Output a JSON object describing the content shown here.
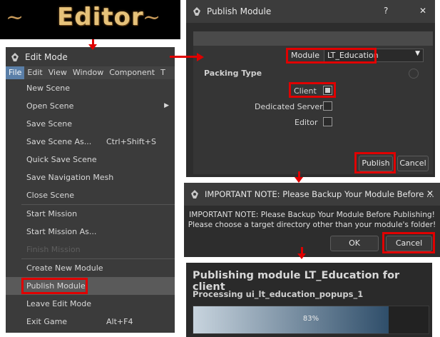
{
  "banner": {
    "title": "Editor"
  },
  "edit_window": {
    "title": "Edit Mode",
    "menubar": [
      "File",
      "Edit",
      "View",
      "Window",
      "Component",
      "T"
    ],
    "menu_items": [
      {
        "label": "New Scene",
        "shortcut": ""
      },
      {
        "label": "Open Scene",
        "shortcut": "",
        "submenu": true
      },
      {
        "label": "Save Scene",
        "shortcut": ""
      },
      {
        "label": "Save Scene As...",
        "shortcut": "Ctrl+Shift+S"
      },
      {
        "label": "Quick Save Scene",
        "shortcut": ""
      },
      {
        "label": "Save Navigation Mesh",
        "shortcut": ""
      },
      {
        "label": "Close Scene",
        "shortcut": ""
      },
      {
        "label": "Start Mission",
        "shortcut": ""
      },
      {
        "label": "Start Mission As...",
        "shortcut": ""
      },
      {
        "label": "Finish Mission",
        "shortcut": "",
        "disabled": true
      },
      {
        "label": "Create New Module",
        "shortcut": ""
      },
      {
        "label": "Publish Module",
        "shortcut": "",
        "highlighted": true
      },
      {
        "label": "Leave Edit Mode",
        "shortcut": ""
      },
      {
        "label": "Exit Game",
        "shortcut": "Alt+F4"
      }
    ]
  },
  "publish_dialog": {
    "title": "Publish Module",
    "help": "?",
    "close": "✕",
    "module_label": "Module",
    "module_value": "LT_Education",
    "packing_type_label": "Packing Type",
    "options": [
      {
        "label": "Client",
        "checked": true
      },
      {
        "label": "Dedicated Server",
        "checked": false
      },
      {
        "label": "Editor",
        "checked": false
      }
    ],
    "publish_button": "Publish",
    "cancel_button": "Cancel"
  },
  "backup_dialog": {
    "title": "IMPORTANT NOTE: Please Backup Your Module Before ...",
    "close": "✕",
    "message_line1": "IMPORTANT NOTE: Please Backup Your Module Before Publishing!",
    "message_line2": "Please choose a target directory other than your module's folder!",
    "ok_button": "OK",
    "cancel_button": "Cancel"
  },
  "progress_dialog": {
    "title": "Publishing module LT_Education for client",
    "status": "Processing ui_lt_education_popups_1",
    "progress": 0.83,
    "progress_label": "83%"
  },
  "colors": {
    "highlight_red": "#e00000",
    "menu_selected": "#5a7fa8",
    "progress_fill": "#4a6a86"
  }
}
